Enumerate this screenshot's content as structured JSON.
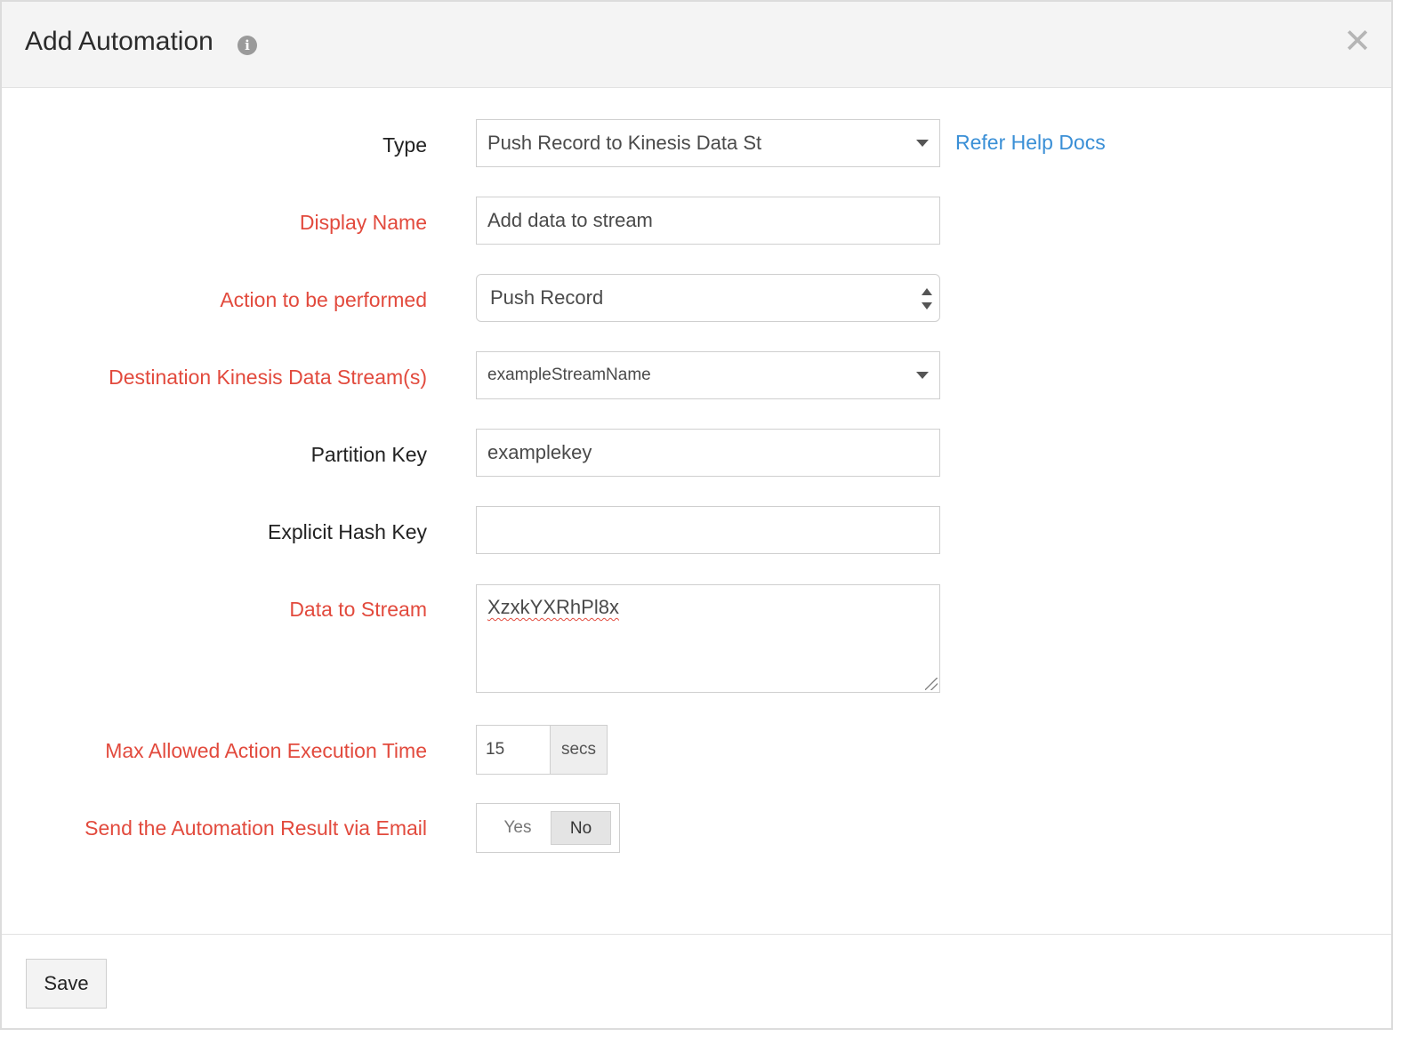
{
  "dialog": {
    "title": "Add Automation",
    "info_icon": "info-icon",
    "close_icon": "close-icon"
  },
  "form": {
    "type": {
      "label": "Type",
      "value": "Push Record to Kinesis Data St",
      "help_link": "Refer Help Docs"
    },
    "display_name": {
      "label": "Display Name",
      "value": "Add data to stream"
    },
    "action": {
      "label": "Action to be performed",
      "value": "Push Record"
    },
    "destination": {
      "label": "Destination Kinesis Data Stream(s)",
      "value": "exampleStreamName"
    },
    "partition_key": {
      "label": "Partition Key",
      "value": "examplekey"
    },
    "explicit_hash_key": {
      "label": "Explicit Hash Key",
      "value": ""
    },
    "data_to_stream": {
      "label": "Data to Stream",
      "value": "XzxkYXRhPl8x"
    },
    "max_time": {
      "label": "Max Allowed Action Execution Time",
      "value": "15",
      "unit": "secs"
    },
    "send_email": {
      "label": "Send the Automation Result via Email",
      "yes": "Yes",
      "no": "No",
      "selected": "No"
    }
  },
  "footer": {
    "save_label": "Save"
  },
  "colors": {
    "required_label": "#e24a3d",
    "link": "#3a8fd6",
    "header_bg": "#f4f4f4"
  }
}
